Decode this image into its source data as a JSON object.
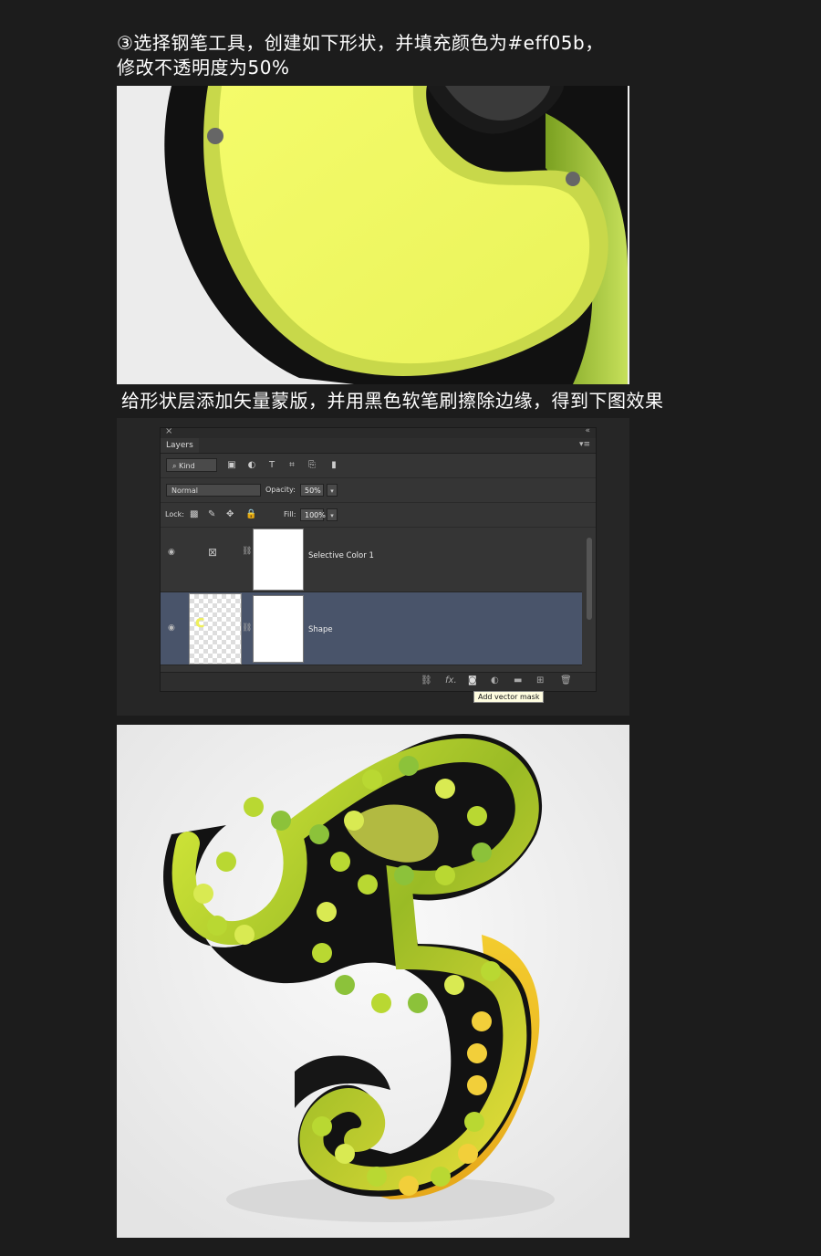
{
  "captions": {
    "step3_line1": "③选择钢笔工具，创建如下形状，并填充颜色为#eff05b，",
    "step3_line2": "修改不透明度为50%",
    "step4": "给形状层添加矢量蒙版，并用黑色软笔刷擦除边缘，得到下图效果"
  },
  "layers_panel": {
    "close": "×",
    "collapse": "«",
    "tab_label": "Layers",
    "menu": "▾≡",
    "filter_kind": "Kind",
    "blend_mode": "Normal",
    "opacity_label": "Opacity:",
    "opacity_value": "50%",
    "lock_label": "Lock:",
    "fill_label": "Fill:",
    "fill_value": "100%",
    "layers": [
      {
        "name": "Selective Color 1"
      },
      {
        "name": "Shape"
      }
    ],
    "tooltip": "Add vector mask",
    "fx": "fx."
  },
  "colors": {
    "shape_fill": "#eff05b",
    "selected_layer": "#49546a",
    "background": "#1c1c1c"
  }
}
